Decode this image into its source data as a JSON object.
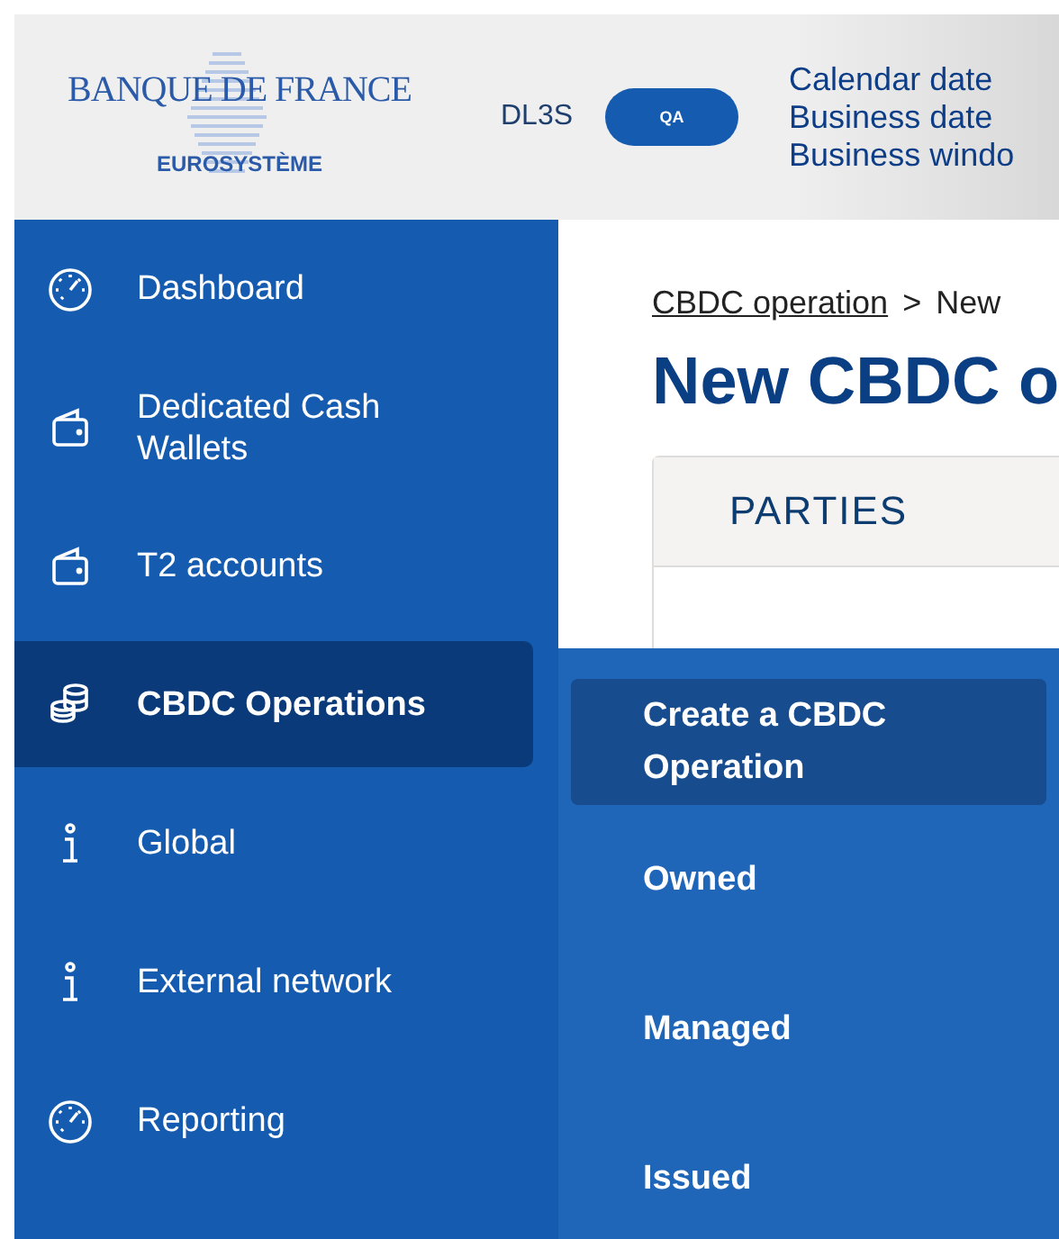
{
  "header": {
    "logo": {
      "name": "BANQUE DE FRANCE",
      "subtitle": "EUROSYSTÈME"
    },
    "environment": "DL3S",
    "badge": "QA",
    "dates": [
      "Calendar date",
      "Business date",
      "Business windo"
    ]
  },
  "sidebar": {
    "items": [
      {
        "label": "Dashboard",
        "kind": "gauge",
        "selected": false
      },
      {
        "label": "Dedicated Cash Wallets",
        "kind": "wallet",
        "selected": false
      },
      {
        "label": "T2 accounts",
        "kind": "wallet",
        "selected": false
      },
      {
        "label": "CBDC Operations",
        "kind": "coins",
        "selected": true
      },
      {
        "label": "Global",
        "kind": "info",
        "selected": false
      },
      {
        "label": "External network",
        "kind": "info",
        "selected": false
      },
      {
        "label": "Reporting",
        "kind": "gauge",
        "selected": false
      }
    ]
  },
  "submenu": {
    "items": [
      {
        "label": "Create a CBDC Operation",
        "selected": true
      },
      {
        "label": "Owned",
        "selected": false
      },
      {
        "label": "Managed",
        "selected": false
      },
      {
        "label": "Issued",
        "selected": false
      }
    ]
  },
  "breadcrumb": {
    "link": "CBDC operation",
    "separator": ">",
    "current": "New"
  },
  "title": "New CBDC o",
  "card": {
    "section": "PARTIES"
  }
}
